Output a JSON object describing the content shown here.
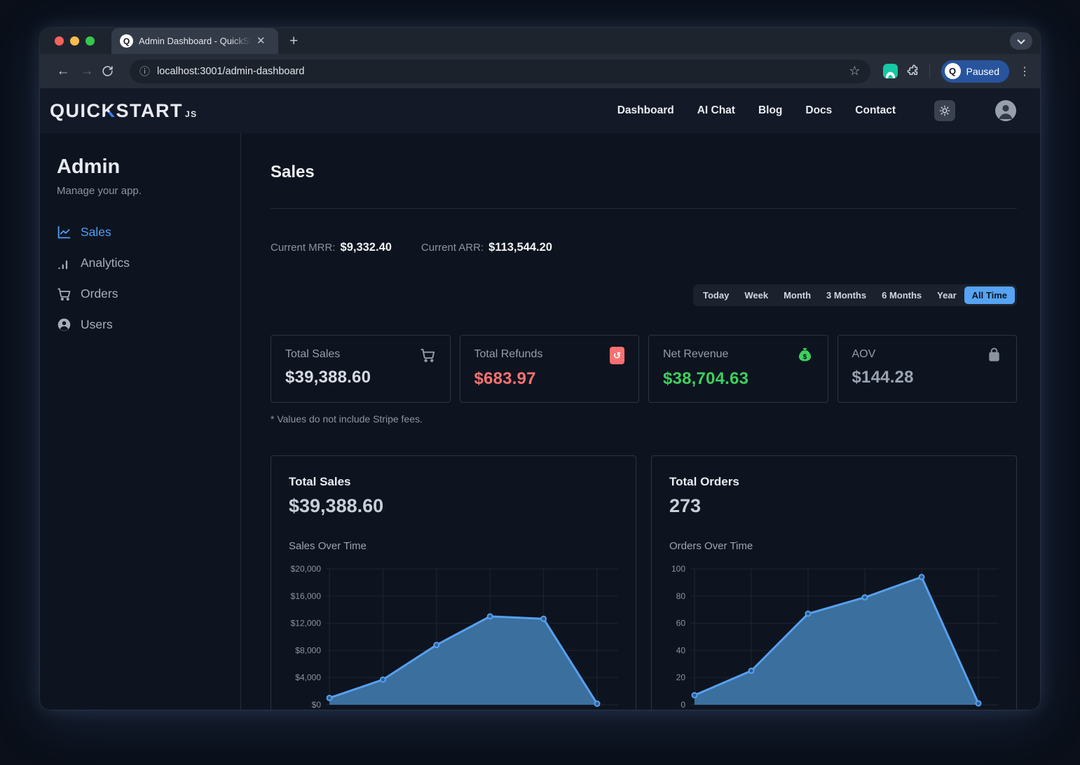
{
  "colors": {
    "accent": "#4f9df3",
    "negative": "#f87171",
    "positive": "#3ecf5e"
  },
  "browser": {
    "tab_title": "Admin Dashboard - QuickStart",
    "favicon_letter": "Q",
    "url": "localhost:3001/admin-dashboard",
    "paused_label": "Paused",
    "paused_letter": "Q"
  },
  "header": {
    "logo": {
      "part1": "QUIC",
      "accent": "K",
      "part2": "START",
      "suffix": "JS"
    },
    "nav": [
      {
        "label": "Dashboard"
      },
      {
        "label": "AI Chat"
      },
      {
        "label": "Blog"
      },
      {
        "label": "Docs"
      },
      {
        "label": "Contact"
      }
    ]
  },
  "sidebar": {
    "title": "Admin",
    "subtitle": "Manage your app.",
    "items": [
      {
        "label": "Sales",
        "active": true
      },
      {
        "label": "Analytics",
        "active": false
      },
      {
        "label": "Orders",
        "active": false
      },
      {
        "label": "Users",
        "active": false
      }
    ]
  },
  "main": {
    "title": "Sales",
    "mrr_label": "Current MRR:",
    "mrr_value": "$9,332.40",
    "arr_label": "Current ARR:",
    "arr_value": "$113,544.20",
    "range_tabs": [
      {
        "label": "Today"
      },
      {
        "label": "Week"
      },
      {
        "label": "Month"
      },
      {
        "label": "3 Months"
      },
      {
        "label": "6 Months"
      },
      {
        "label": "Year"
      },
      {
        "label": "All Time",
        "active": true
      }
    ],
    "stats": [
      {
        "label": "Total Sales",
        "value": "$39,388.60",
        "icon": "cart-icon"
      },
      {
        "label": "Total Refunds",
        "value": "$683.97",
        "icon": "refund-icon"
      },
      {
        "label": "Net Revenue",
        "value": "$38,704.63",
        "icon": "money-bag-icon",
        "icon_char": "$"
      },
      {
        "label": "AOV",
        "value": "$144.28",
        "icon": "shopping-bag-icon"
      }
    ],
    "footnote": "* Values do not include Stripe fees."
  },
  "chart_data": [
    {
      "type": "area",
      "title": "Total Sales",
      "total": "$39,388.60",
      "subtitle": "Sales Over Time",
      "values": [
        1000,
        3700,
        8800,
        13000,
        12650,
        150
      ],
      "ylim": [
        0,
        20000
      ],
      "yticks": [
        0,
        4000,
        8000,
        12000,
        16000,
        20000
      ],
      "ytick_labels": [
        "$0",
        "$4,000",
        "$8,000",
        "$12,000",
        "$16,000",
        "$20,000"
      ],
      "grid": true,
      "x_axis_labels_visible": false,
      "line_color": "#57a0ef",
      "fill_color": "#3a6f9e",
      "point_fill": "#2b5f93"
    },
    {
      "type": "area",
      "title": "Total Orders",
      "total": "273",
      "subtitle": "Orders Over Time",
      "values": [
        7,
        25,
        67,
        79,
        94,
        1
      ],
      "ylim": [
        0,
        100
      ],
      "yticks": [
        0,
        20,
        40,
        60,
        80,
        100
      ],
      "ytick_labels": [
        "0",
        "20",
        "40",
        "60",
        "80",
        "100"
      ],
      "grid": true,
      "x_axis_labels_visible": false,
      "line_color": "#57a0ef",
      "fill_color": "#3a6f9e",
      "point_fill": "#2b5f93"
    }
  ]
}
